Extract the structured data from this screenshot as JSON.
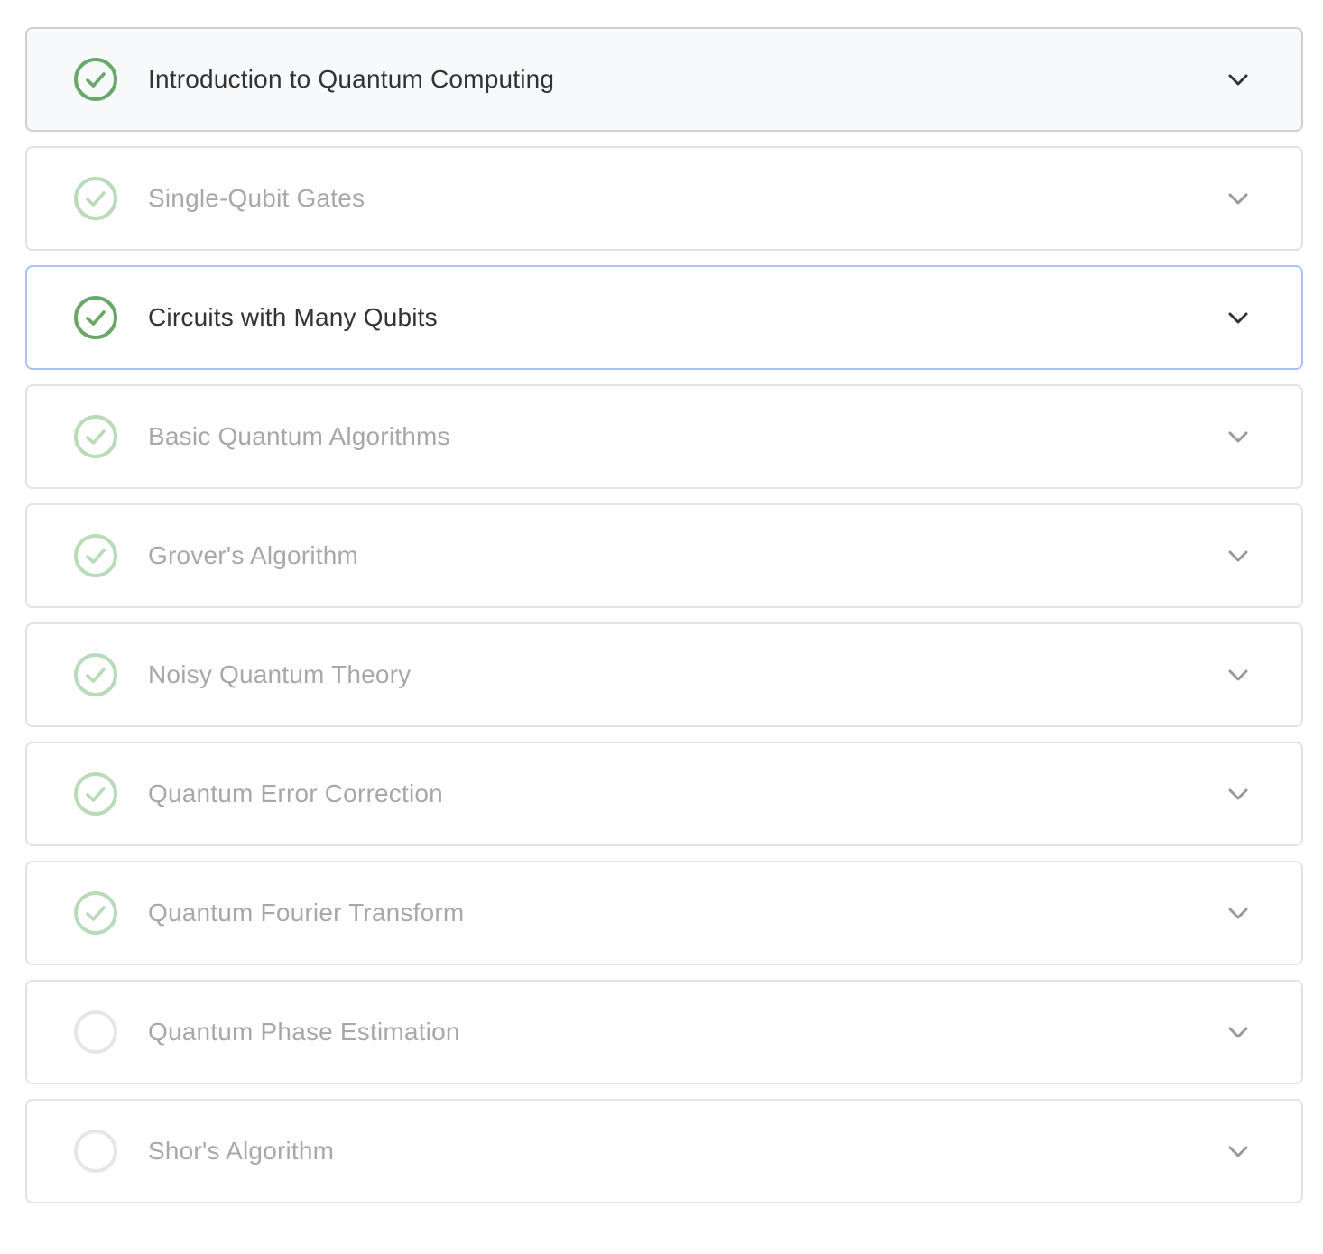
{
  "colors": {
    "check_active": "#6aa86a",
    "check_done": "#b9dbb9",
    "check_empty": "#e6e6e6",
    "chevron_active": "#333333",
    "chevron_muted": "#999999"
  },
  "modules": [
    {
      "label": "Introduction to Quantum Computing",
      "status": "completed",
      "state": "hovered"
    },
    {
      "label": "Single-Qubit Gates",
      "status": "completed",
      "state": "normal"
    },
    {
      "label": "Circuits with Many Qubits",
      "status": "completed",
      "state": "focused"
    },
    {
      "label": "Basic Quantum Algorithms",
      "status": "completed",
      "state": "normal"
    },
    {
      "label": "Grover's Algorithm",
      "status": "completed",
      "state": "normal"
    },
    {
      "label": "Noisy Quantum Theory",
      "status": "completed",
      "state": "normal"
    },
    {
      "label": "Quantum Error Correction",
      "status": "completed",
      "state": "normal"
    },
    {
      "label": "Quantum Fourier Transform",
      "status": "completed",
      "state": "normal"
    },
    {
      "label": "Quantum Phase Estimation",
      "status": "not-started",
      "state": "normal"
    },
    {
      "label": "Shor's Algorithm",
      "status": "not-started",
      "state": "normal"
    }
  ]
}
